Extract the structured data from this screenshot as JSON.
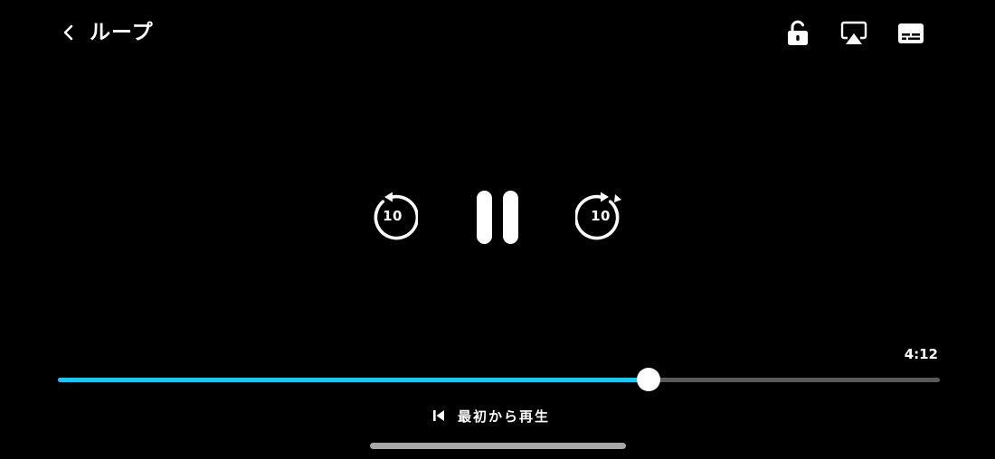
{
  "header": {
    "title": "ループ",
    "back_icon": "chevron-left-icon"
  },
  "toolbar": {
    "icons": [
      "unlock-icon",
      "airplay-icon",
      "subtitles-icon"
    ]
  },
  "controls": {
    "rewind_seconds": "10",
    "forward_seconds": "10",
    "state": "playing"
  },
  "progress": {
    "duration": "4:12",
    "played_fraction": 0.67
  },
  "restart": {
    "label": "最初から再生",
    "icon": "skip-to-start-icon"
  },
  "colors": {
    "background": "#000000",
    "progress_fill": "#1fc6f0",
    "progress_track": "#5a5a5a",
    "foreground": "#ffffff"
  }
}
